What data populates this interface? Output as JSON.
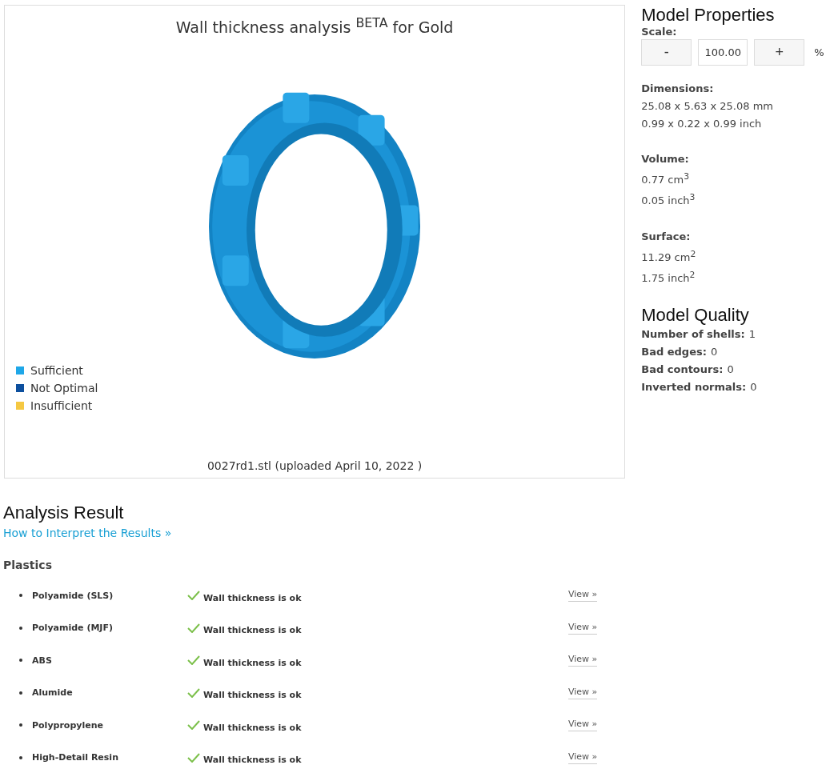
{
  "viewer": {
    "title": "Wall thickness analysis $^{BETA}$ for Gold",
    "legend": [
      {
        "label": "Sufficient",
        "color": "#1ea7e8"
      },
      {
        "label": "Not Optimal",
        "color": "#0d4f9e"
      },
      {
        "label": "Insufficient",
        "color": "#f5c842"
      }
    ],
    "file_caption": "0027rd1.stl (uploaded April 10, 2022 )"
  },
  "properties": {
    "title": "Model Properties",
    "scale": {
      "label": "Scale:",
      "minus": "-",
      "value": "100.00",
      "plus": "+",
      "unit": "%"
    },
    "groups": [
      {
        "label": "Dimensions:",
        "lines": [
          "25.08 x 5.63 x 25.08 mm",
          "0.99 x 0.22 x 0.99 inch"
        ]
      },
      {
        "label": "Volume:",
        "lines": [
          "0.77 cm$^{3}$",
          "0.05 inch$^{3}$"
        ]
      },
      {
        "label": "Surface:",
        "lines": [
          "11.29 cm$^{2}$",
          "1.75 inch$^{2}$"
        ]
      }
    ]
  },
  "quality": {
    "title": "Model Quality",
    "items": [
      {
        "label": "Number of shells:",
        "value": "1"
      },
      {
        "label": "Bad edges:",
        "value": "0"
      },
      {
        "label": "Bad contours:",
        "value": "0"
      },
      {
        "label": "Inverted normals:",
        "value": "0"
      }
    ]
  },
  "analysis": {
    "title": "Analysis Result",
    "help_link": "How to Interpret the Results »",
    "category": "Plastics",
    "rows": [
      {
        "material": "Polyamide (SLS)",
        "ok": true,
        "message": "Wall thickness is ok",
        "action": "View »"
      },
      {
        "material": "Polyamide (MJF)",
        "ok": true,
        "message": "Wall thickness is ok",
        "action": "View »"
      },
      {
        "material": "ABS",
        "ok": true,
        "message": "Wall thickness is ok",
        "action": "View »"
      },
      {
        "material": "Alumide",
        "ok": true,
        "message": "Wall thickness is ok",
        "action": "View »"
      },
      {
        "material": "Polypropylene",
        "ok": true,
        "message": "Wall thickness is ok",
        "action": "View »"
      },
      {
        "material": "High-Detail Resin",
        "ok": true,
        "message": "Wall thickness is ok",
        "action": "View »"
      }
    ]
  }
}
